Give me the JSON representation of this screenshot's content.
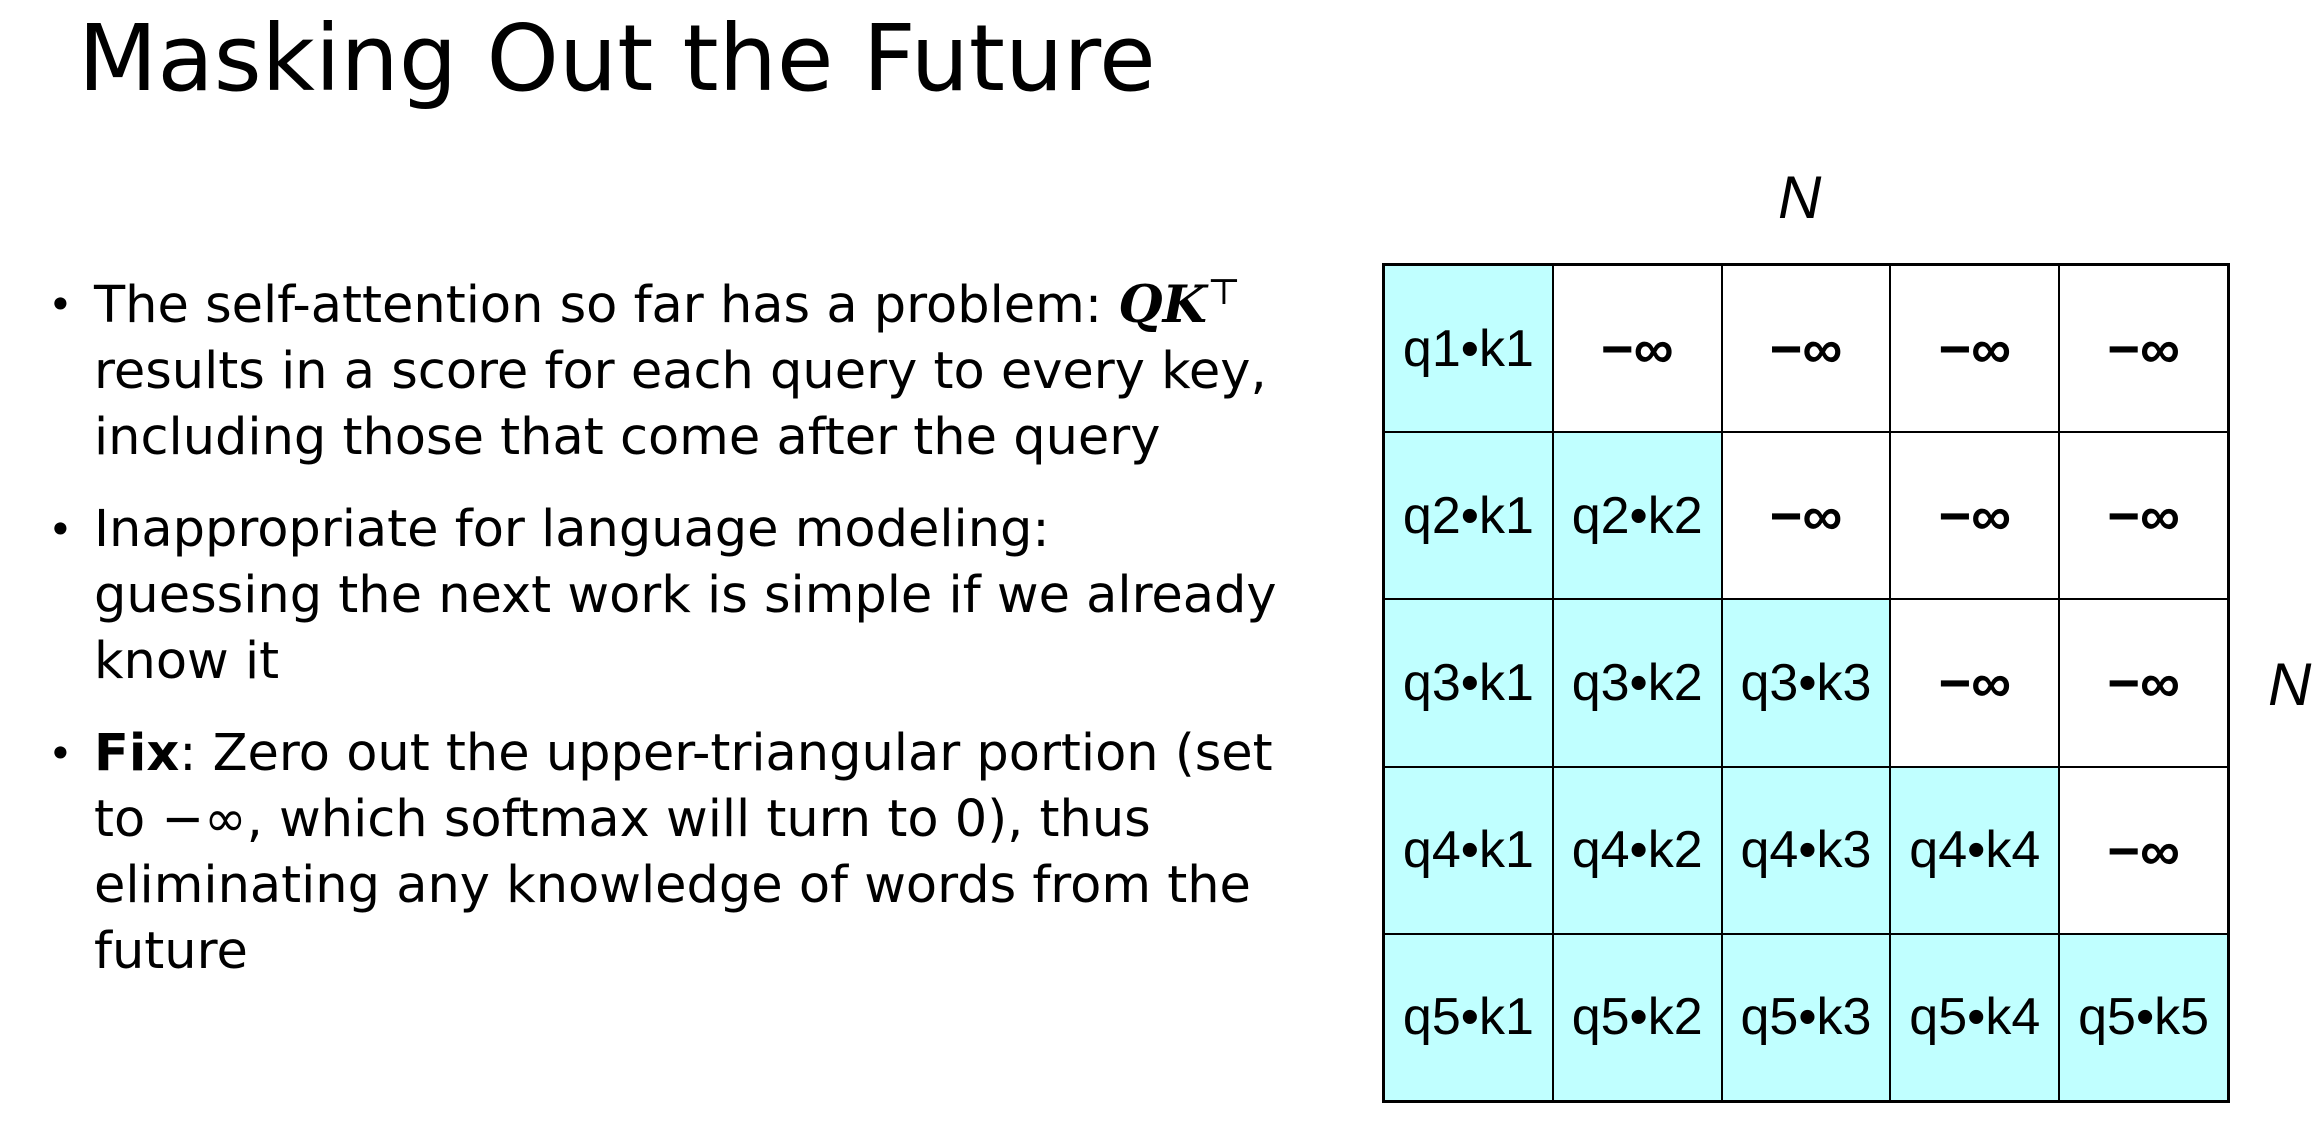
{
  "slide": {
    "title": "Masking Out the Future",
    "bullets": [
      {
        "marker": "•",
        "text_before": "The self-attention so far has a problem: ",
        "math": "QK",
        "math_sup": "⊤",
        "text_after": "results in a score for each query to every key, including those that come after the query"
      },
      {
        "marker": "•",
        "text": "Inappropriate for language modeling: guessing the next work is simple if we already know it"
      },
      {
        "marker": "•",
        "bold": "Fix",
        "text": ": Zero out the upper-triangular portion (set to −∞, which softmax will turn to 0), thus eliminating any knowledge of words from the future"
      }
    ]
  },
  "matrix": {
    "top_label": "N",
    "side_label": "N",
    "visible_color": "#c0ffff",
    "masked_color": "#ffffff",
    "rows": [
      [
        "q1•k1",
        "−∞",
        "−∞",
        "−∞",
        "−∞"
      ],
      [
        "q2•k1",
        "q2•k2",
        "−∞",
        "−∞",
        "−∞"
      ],
      [
        "q3•k1",
        "q3•k2",
        "q3•k3",
        "−∞",
        "−∞"
      ],
      [
        "q4•k1",
        "q4•k2",
        "q4•k3",
        "q4•k4",
        "−∞"
      ],
      [
        "q5•k1",
        "q5•k2",
        "q5•k3",
        "q5•k4",
        "q5•k5"
      ]
    ]
  }
}
